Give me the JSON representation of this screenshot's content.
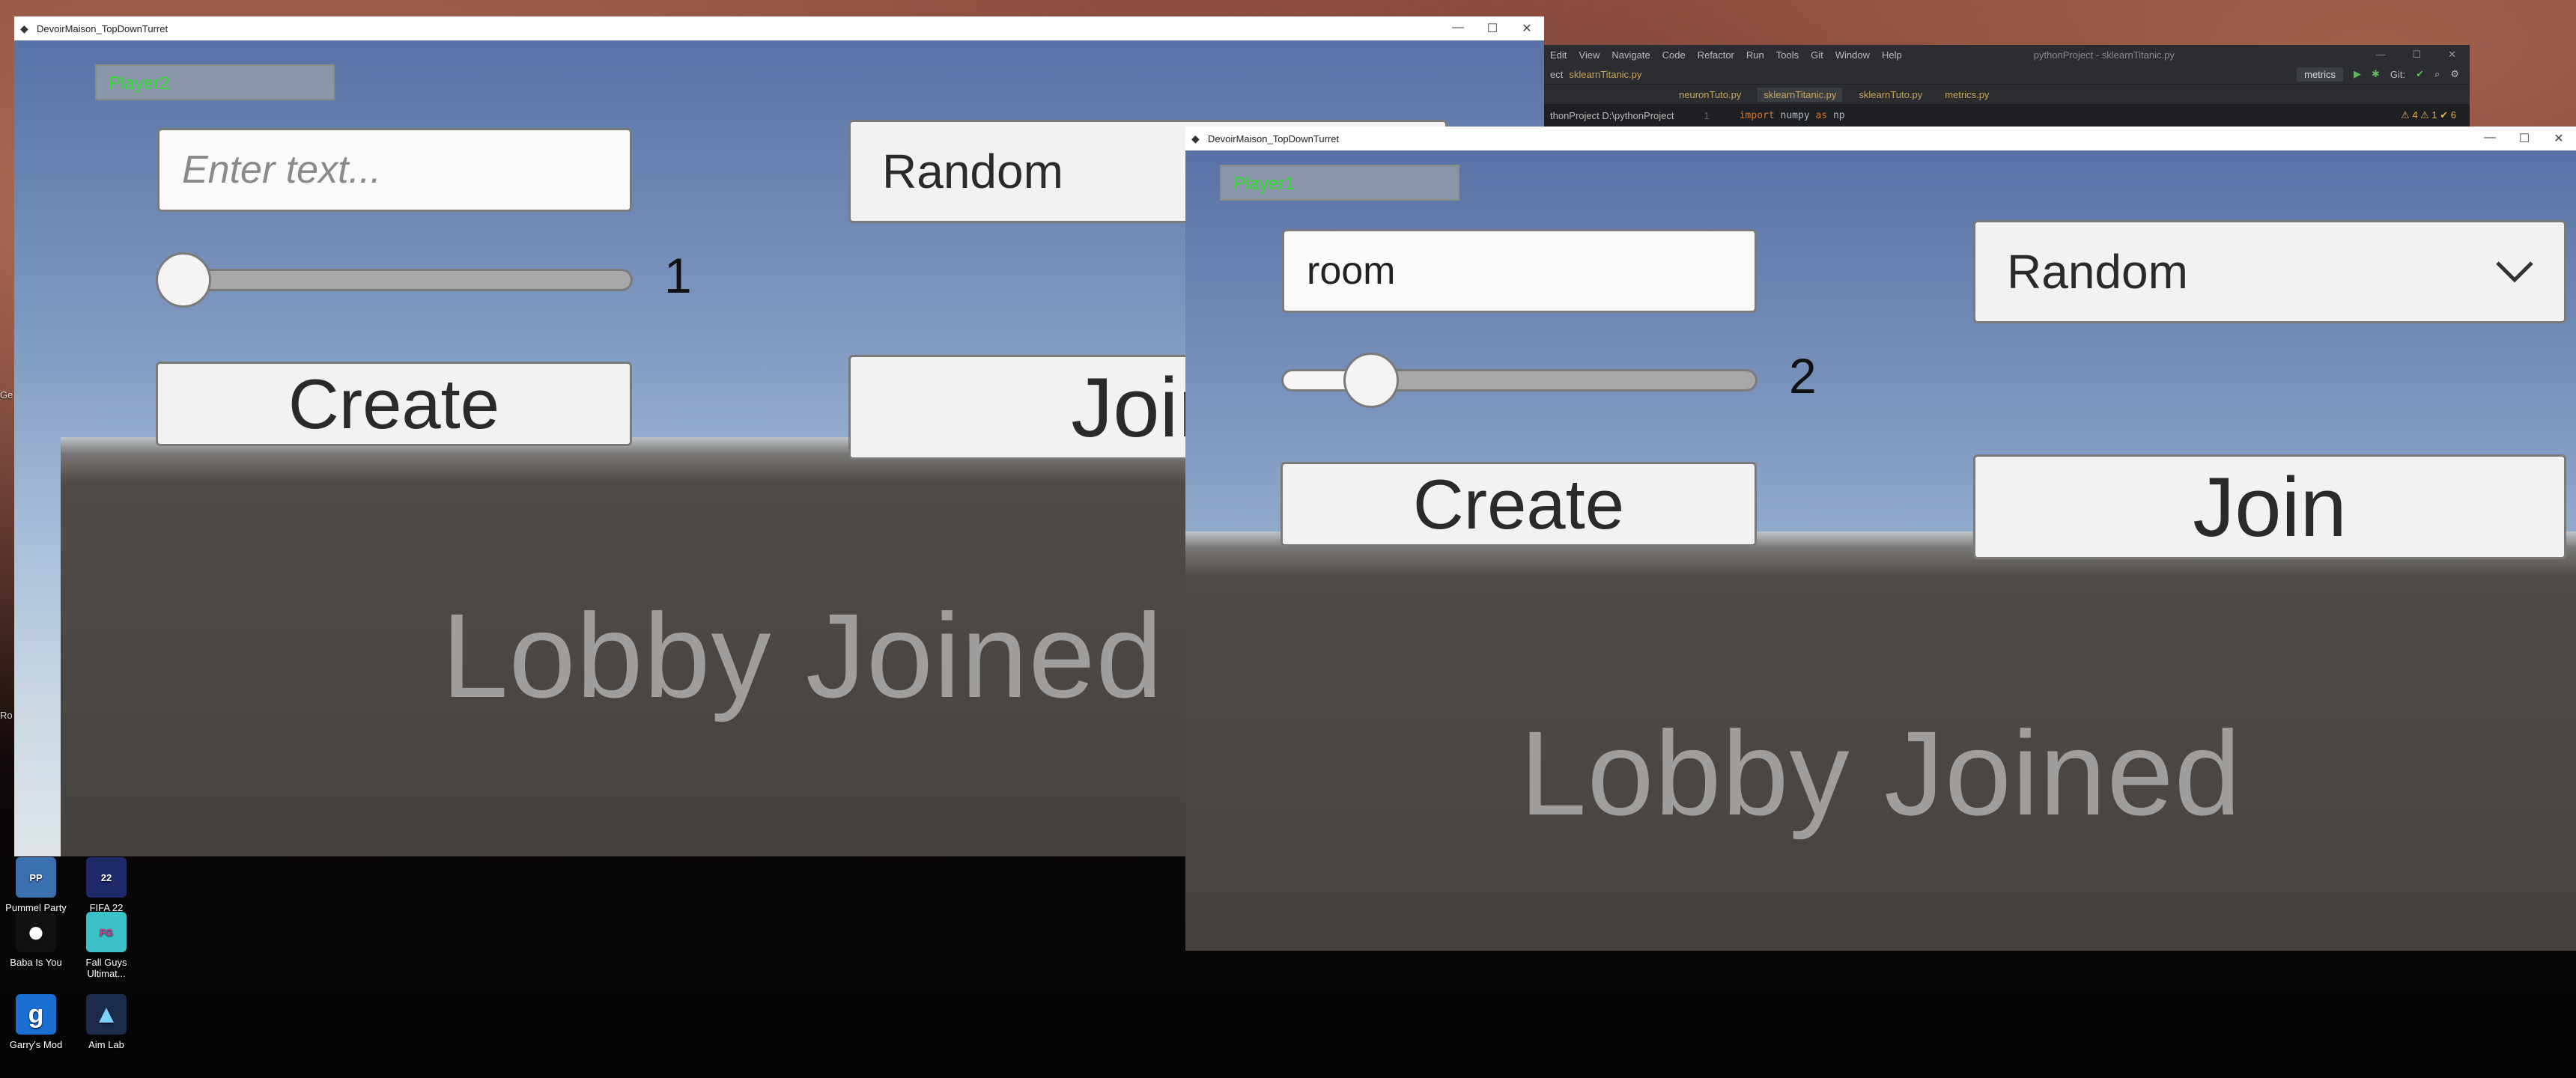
{
  "desktop": {
    "icons": [
      {
        "label": "Pummel Party",
        "icon": "pummel-party-icon",
        "color": "#3a6fb0"
      },
      {
        "label": "FIFA 22",
        "icon": "fifa-icon",
        "color": "#1f2a6b"
      },
      {
        "label": "Baba Is You",
        "icon": "baba-icon",
        "color": "#111111"
      },
      {
        "label": "Fall Guys Ultimat...",
        "icon": "fall-guys-icon",
        "color": "#3ec0c8"
      },
      {
        "label": "Garry's Mod",
        "icon": "garrys-mod-icon",
        "color": "#1a6fd0"
      },
      {
        "label": "Aim Lab",
        "icon": "aim-lab-icon",
        "color": "#1b2b4a"
      }
    ]
  },
  "ide": {
    "menu": [
      "Edit",
      "View",
      "Navigate",
      "Code",
      "Refactor",
      "Run",
      "Tools",
      "Git",
      "Window",
      "Help"
    ],
    "title": "pythonProject - sklearnTitanic.py",
    "breadcrumb_file": "sklearnTitanic.py",
    "project_label": "ect",
    "run_config": "metrics",
    "git_label": "Git:",
    "tabs": [
      "neuronTuto.py",
      "sklearnTitanic.py",
      "sklearnTuto.py",
      "metrics.py"
    ],
    "project_path": "thonProject D:\\pythonProject",
    "line_number": "1",
    "code_line": {
      "keyword": "import",
      "module": "numpy",
      "as": "as",
      "alias": "np"
    },
    "warnings": "⚠ 4  ⚠ 1  ✔ 6"
  },
  "left_window": {
    "title": "DevoirMaison_TopDownTurret",
    "player_label": "Player2",
    "text_placeholder": "Enter text...",
    "slider_value": "1",
    "slider_fraction": 0.0,
    "dropdown_value": "Random",
    "create_label": "Create",
    "join_label": "Join",
    "status": "Lobby Joined"
  },
  "right_window": {
    "title": "DevoirMaison_TopDownTurret",
    "player_label": "Player1",
    "text_value": "room",
    "slider_value": "2",
    "slider_fraction": 0.15,
    "dropdown_value": "Random",
    "create_label": "Create",
    "join_label": "Join",
    "status": "Lobby Joined"
  },
  "window_controls": {
    "minimize": "—",
    "maximize": "☐",
    "close": "✕"
  }
}
